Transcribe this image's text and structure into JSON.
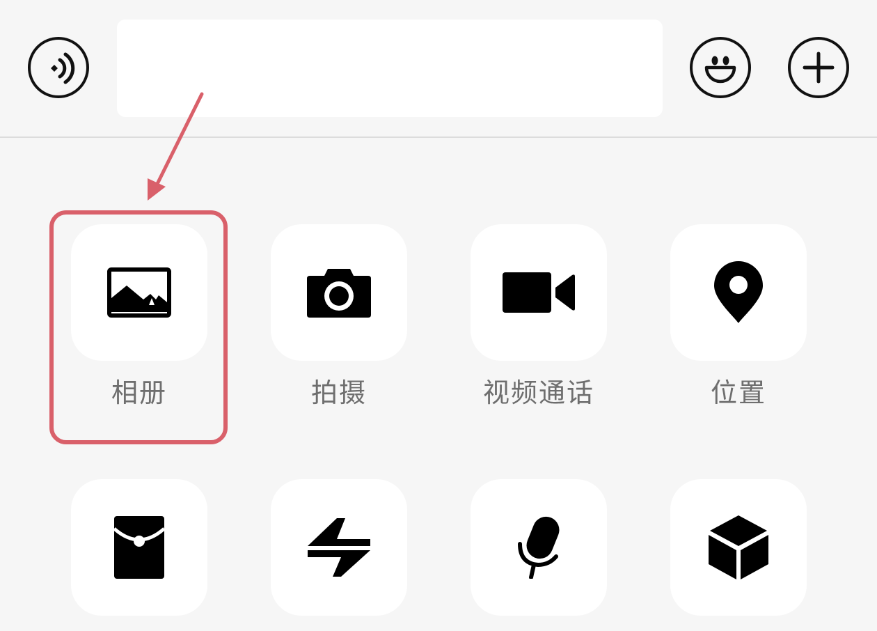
{
  "input_bar": {
    "voice_icon": "voice-wave-icon",
    "message_value": "",
    "emoji_icon": "smiley-face-icon",
    "more_icon": "plus-circle-icon"
  },
  "panel": {
    "items": [
      {
        "label": "相册",
        "icon": "photo-album-icon"
      },
      {
        "label": "拍摄",
        "icon": "camera-icon"
      },
      {
        "label": "视频通话",
        "icon": "video-camera-icon"
      },
      {
        "label": "位置",
        "icon": "location-pin-icon"
      },
      {
        "label": "",
        "icon": "red-packet-icon"
      },
      {
        "label": "",
        "icon": "transfer-arrows-icon"
      },
      {
        "label": "",
        "icon": "voice-input-microphone-icon"
      },
      {
        "label": "",
        "icon": "cube-icon"
      }
    ]
  },
  "annotation": {
    "color": "#d9606a",
    "target": "相册"
  }
}
